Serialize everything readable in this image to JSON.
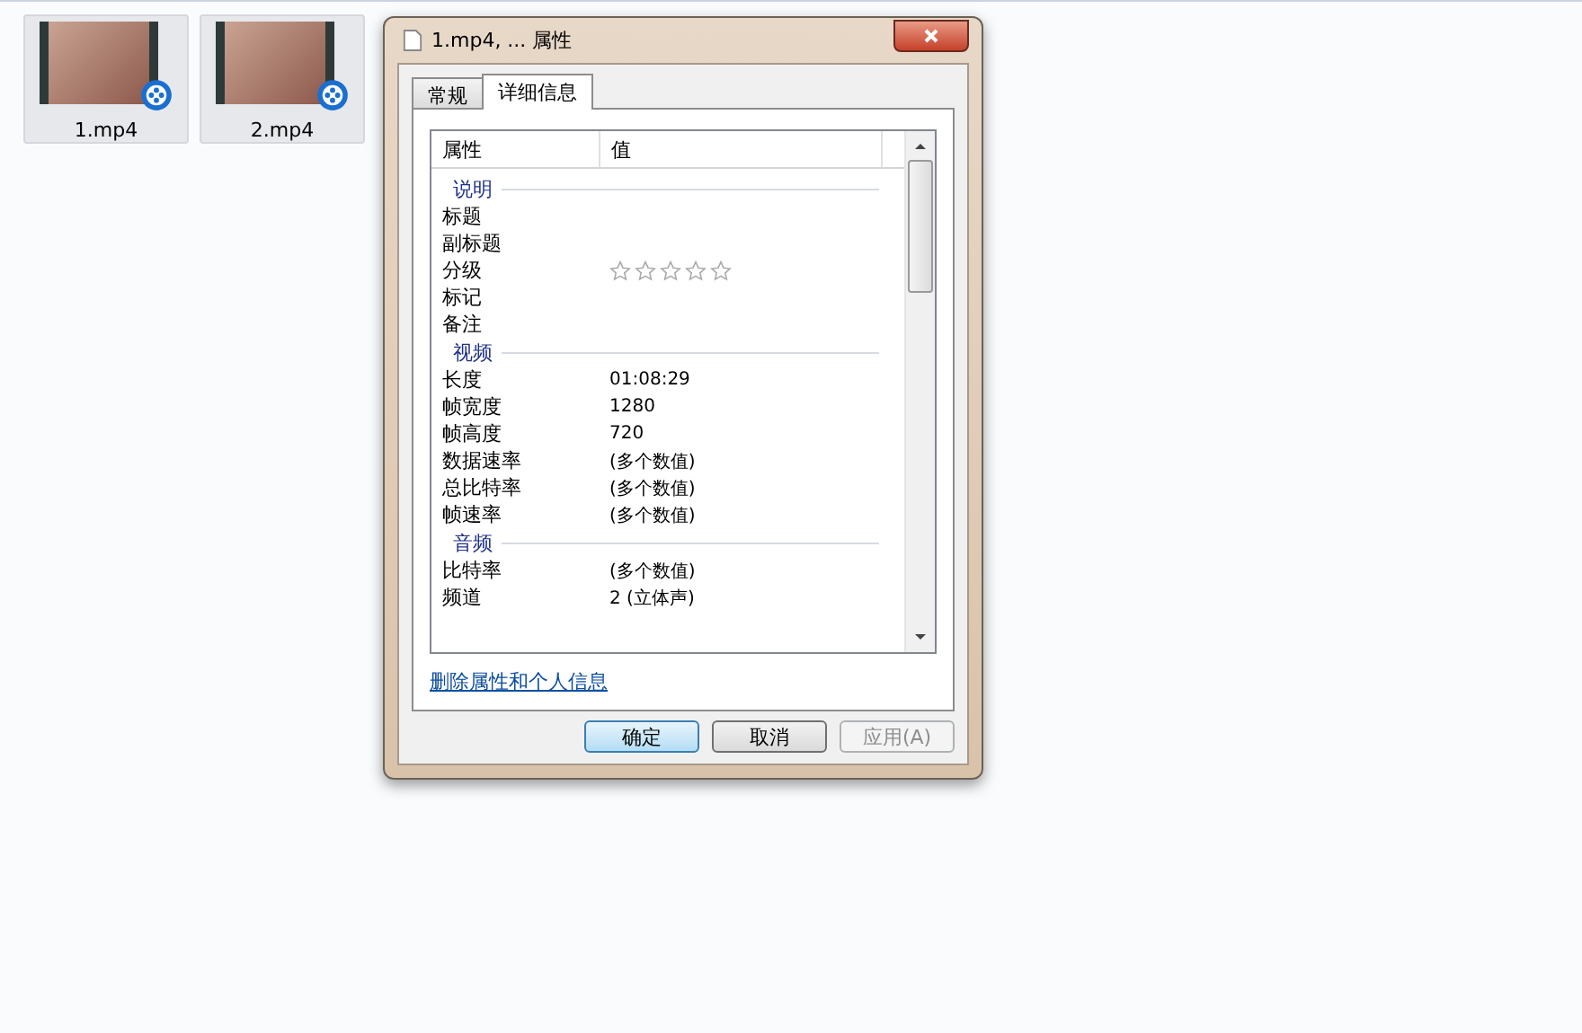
{
  "files": [
    {
      "name": "1.mp4",
      "selected": true
    },
    {
      "name": "2.mp4",
      "selected": true
    }
  ],
  "dialog": {
    "title": "1.mp4, ... 属性",
    "tabs": [
      {
        "label": "常规",
        "selected": false
      },
      {
        "label": "详细信息",
        "selected": true
      }
    ],
    "columns": [
      "属性",
      "值"
    ],
    "groups": [
      {
        "label": "说明",
        "rows": [
          {
            "kind": "text",
            "name": "标题"
          },
          {
            "kind": "text",
            "name": "副标题"
          },
          {
            "kind": "rating",
            "name": "分级",
            "stars": 0
          },
          {
            "kind": "text",
            "name": "标记"
          },
          {
            "kind": "text",
            "name": "备注"
          }
        ]
      },
      {
        "label": "视频",
        "rows": [
          {
            "kind": "text",
            "name": "长度",
            "value": "01:08:29"
          },
          {
            "kind": "text",
            "name": "帧宽度",
            "value": "1280"
          },
          {
            "kind": "text",
            "name": "帧高度",
            "value": "720"
          },
          {
            "kind": "text",
            "name": "数据速率",
            "value": "(多个数值)"
          },
          {
            "kind": "text",
            "name": "总比特率",
            "value": "(多个数值)"
          },
          {
            "kind": "text",
            "name": "帧速率",
            "value": "(多个数值)"
          }
        ]
      },
      {
        "label": "音频",
        "rows": [
          {
            "kind": "text",
            "name": "比特率",
            "value": "(多个数值)"
          },
          {
            "kind": "text",
            "name": "频道",
            "value": "2 (立体声)"
          }
        ]
      }
    ],
    "link": "删除属性和个人信息",
    "buttons": [
      {
        "label": "确定",
        "default": true,
        "disabled": false
      },
      {
        "label": "取消",
        "default": false,
        "disabled": false
      },
      {
        "label": "应用(A)",
        "default": false,
        "disabled": true
      }
    ]
  }
}
